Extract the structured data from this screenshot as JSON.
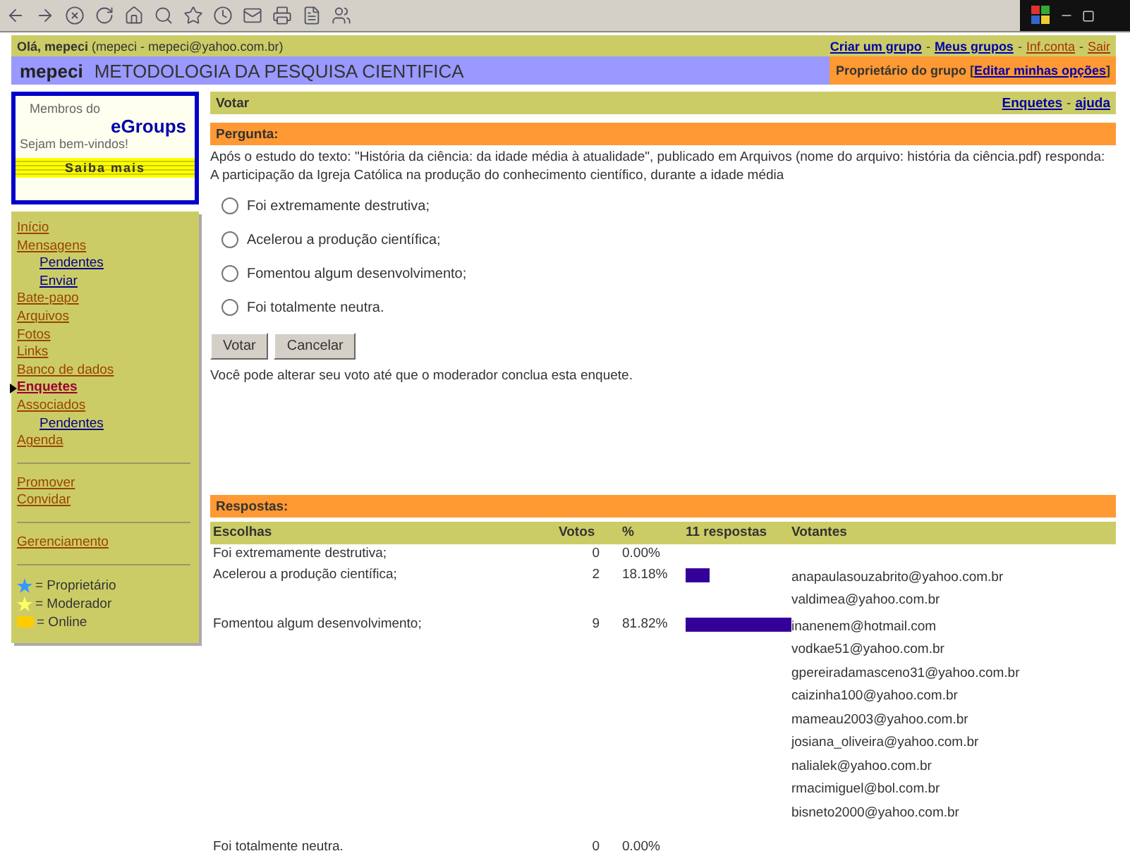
{
  "header": {
    "greeting": "**Olá, mepeci** (mepeci - mepeci@yahoo.com.br)",
    "separator": "-",
    "links": [
      "Criar um grupo",
      "Meus grupos",
      "Inf.conta",
      "Sair"
    ]
  },
  "group": {
    "name": "mepeci",
    "title": "METODOLOGIA DA PESQUISA CIENTIFICA",
    "role": "Proprietário do grupo [",
    "role_link": "Editar minhas opções",
    "role_close": "]"
  },
  "promo": {
    "line1": "Membros do",
    "brand": "eGroups",
    "line2": "Sejam bem-vindos!",
    "button": "Saiba mais"
  },
  "sidebar": {
    "sections": [
      {
        "items": [
          {
            "label": "Início",
            "selected": false
          },
          {
            "label": "Mensagens",
            "selected": false,
            "children": [
              {
                "label": "Pendentes",
                "selected": false
              },
              {
                "label": "Enviar",
                "selected": false
              }
            ]
          },
          {
            "label": "Bate-papo",
            "selected": false
          },
          {
            "label": "Arquivos",
            "selected": false
          },
          {
            "label": "Fotos",
            "selected": false
          },
          {
            "label": "Links",
            "selected": false
          },
          {
            "label": "Banco de dados",
            "selected": false
          },
          {
            "label": "Enquetes",
            "selected": true
          },
          {
            "label": "Associados",
            "selected": false,
            "children": [
              {
                "label": "Pendentes",
                "selected": false
              }
            ]
          },
          {
            "label": "Agenda",
            "selected": false
          }
        ]
      },
      {
        "items": [
          {
            "label": "Promover",
            "selected": false
          },
          {
            "label": "Convidar",
            "selected": false
          }
        ]
      },
      {
        "items": [
          {
            "label": "Gerenciamento",
            "selected": false
          }
        ]
      }
    ],
    "legend": [
      {
        "kind": "owner",
        "label": "= Proprietário"
      },
      {
        "kind": "moderator",
        "label": "= Moderador"
      },
      {
        "kind": "online",
        "label": "= Online"
      }
    ]
  },
  "section": {
    "title": "Votar",
    "links": [
      "Enquetes",
      "ajuda"
    ],
    "separator": "-"
  },
  "question": {
    "heading": "Pergunta:",
    "text": "Após o estudo do texto: \"História da ciência: da idade média à atualidade\", publicado em Arquivos (nome do arquivo: história da ciência.pdf) responda: A participação da Igreja Católica na produção do conhecimento científico, durante a idade média",
    "options": [
      {
        "label": "Foi extremamente destrutiva;",
        "selected": false
      },
      {
        "label": "Acelerou a produção científica;",
        "selected": false
      },
      {
        "label": "Fomentou algum desenvolvimento;",
        "selected": false
      },
      {
        "label": "Foi totalmente neutra.",
        "selected": false
      }
    ],
    "buttons": [
      "Votar",
      "Cancelar"
    ],
    "note": "Você pode alterar seu voto até que o moderador conclua esta enquete."
  },
  "results": {
    "heading": "Respostas:",
    "columns": [
      "Escolhas",
      "Votos",
      "%",
      "11 respostas",
      "Votantes"
    ],
    "rows": [
      {
        "choice": "Foi extremamente destrutiva;",
        "votes": "0",
        "percent": "0.00%",
        "voters": []
      },
      {
        "choice": "Acelerou a produção científica;",
        "votes": "2",
        "percent": "18.18%",
        "voters": [
          "anapaulasouzabrito@yahoo.com.br",
          "valdimea@yahoo.com.br"
        ]
      },
      {
        "choice": "Fomentou algum desenvolvimento;",
        "votes": "9",
        "percent": "81.82%",
        "voters": [
          "inanenem@hotmail.com",
          "vodkae51@yahoo.com.br",
          "gpereiradamasceno31@yahoo.com.br",
          "caizinha100@yahoo.com.br",
          "mameau2003@yahoo.com.br",
          "josiana_oliveira@yahoo.com.br",
          "nalialek@yahoo.com.br",
          "rmacimiguel@bol.com.br",
          "bisneto2000@yahoo.com.br"
        ]
      },
      {
        "choice": "Foi totalmente neutra.",
        "votes": "0",
        "percent": "0.00%",
        "voters": []
      }
    ]
  }
}
